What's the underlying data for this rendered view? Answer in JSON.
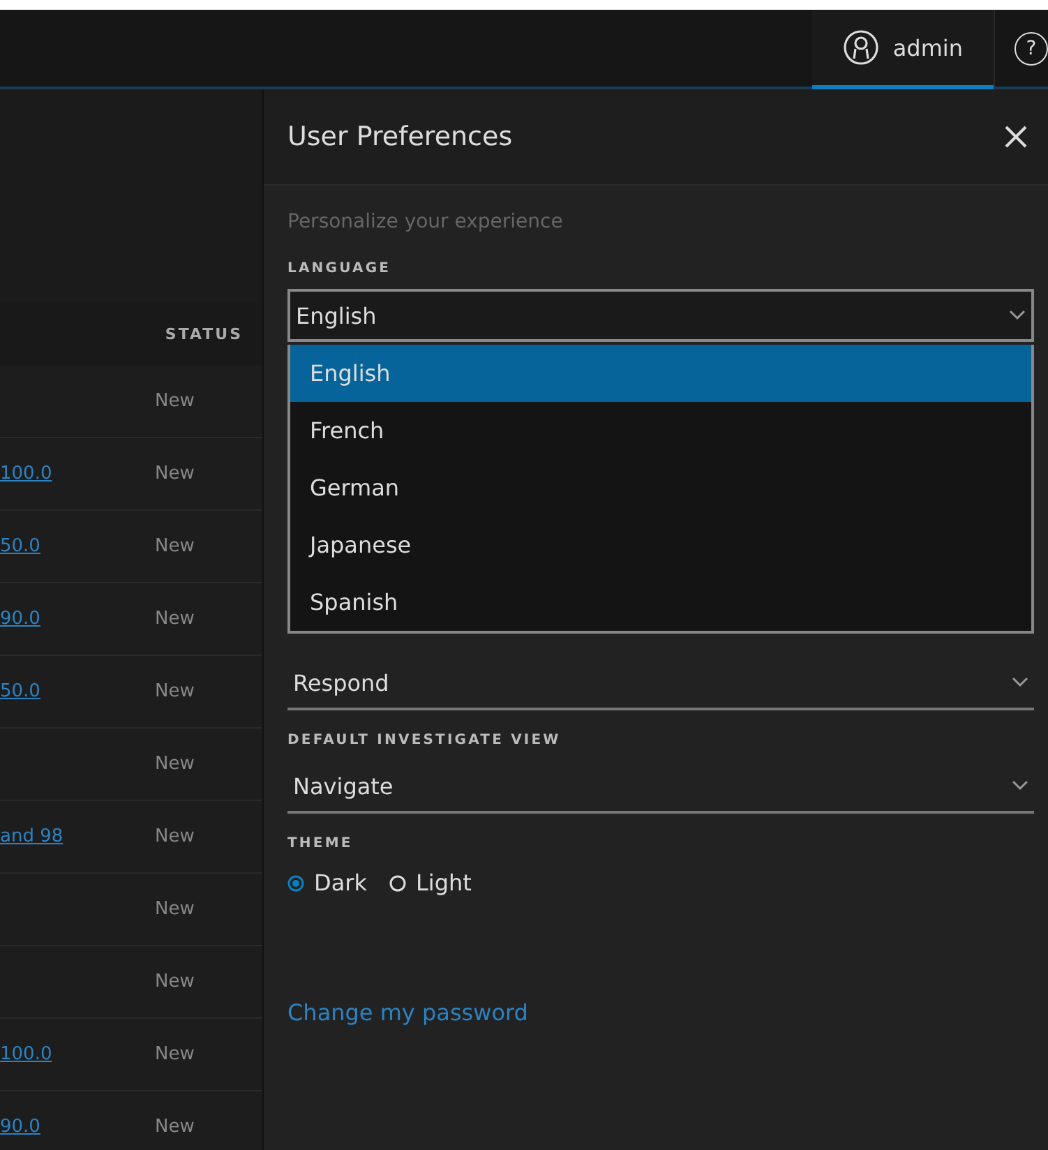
{
  "top_bar": {
    "user": {
      "label": "admin",
      "selected": true
    },
    "help": "?"
  },
  "table": {
    "columns": [
      {
        "label": "STATUS"
      }
    ],
    "rows": [
      {
        "status": "New"
      },
      {
        "link": "100.0",
        "status": "New"
      },
      {
        "link": "50.0",
        "status": "New"
      },
      {
        "link": "90.0",
        "status": "New"
      },
      {
        "link": "50.0",
        "status": "New"
      },
      {
        "status": "New"
      },
      {
        "link": "and 98",
        "status": "New"
      },
      {
        "status": "New"
      },
      {
        "status": "New"
      },
      {
        "link": "100.0",
        "status": "New"
      },
      {
        "link": "90.0",
        "status": "New"
      }
    ]
  },
  "preferences": {
    "title": "User Preferences",
    "subtitle": "Personalize your experience",
    "fields": [
      {
        "kind": "select",
        "label": "LANGUAGE",
        "value": "English",
        "expanded": true,
        "options": [
          {
            "label": "English",
            "selected": true
          },
          {
            "label": "French",
            "selected": false
          },
          {
            "label": "German",
            "selected": false
          },
          {
            "label": "Japanese",
            "selected": false
          },
          {
            "label": "Spanish",
            "selected": false
          }
        ]
      },
      {
        "kind": "select",
        "value": "Respond",
        "expanded": false
      },
      {
        "kind": "select",
        "label": "DEFAULT INVESTIGATE VIEW",
        "value": "Navigate",
        "expanded": false
      },
      {
        "kind": "radio",
        "label": "THEME",
        "options": [
          {
            "label": "Dark",
            "selected": true
          },
          {
            "label": "Light",
            "selected": false
          }
        ]
      }
    ],
    "link": "Change my password"
  }
}
